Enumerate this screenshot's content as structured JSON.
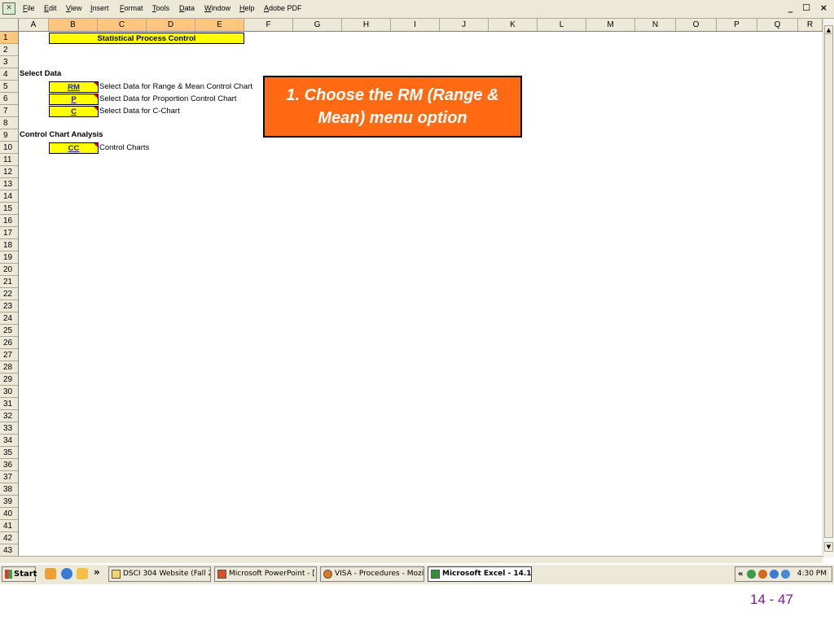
{
  "menubar": {
    "items": [
      "File",
      "Edit",
      "View",
      "Insert",
      "Format",
      "Tools",
      "Data",
      "Window",
      "Help",
      "Adobe PDF"
    ],
    "window_controls": "_ ☐ ×"
  },
  "columns": [
    "A",
    "B",
    "C",
    "D",
    "E",
    "F",
    "G",
    "H",
    "I",
    "J",
    "K",
    "L",
    "M",
    "N",
    "O",
    "P",
    "Q",
    "R"
  ],
  "rows": [
    "1",
    "2",
    "3",
    "4",
    "5",
    "6",
    "7",
    "8",
    "9",
    "10",
    "11",
    "12",
    "13",
    "14",
    "15",
    "16",
    "17",
    "18",
    "19",
    "20",
    "21",
    "22",
    "23",
    "24",
    "25",
    "26",
    "27",
    "28",
    "29",
    "30",
    "31",
    "32",
    "33",
    "34",
    "35",
    "36",
    "37",
    "38",
    "39",
    "40",
    "41",
    "42",
    "43"
  ],
  "sheet": {
    "title": "Statistical Process Control",
    "select_data_heading": "Select Data",
    "select_items": [
      {
        "code": "RM",
        "desc": "Select Data for Range & Mean Control Chart"
      },
      {
        "code": "P",
        "desc": "Select Data for Proportion Control Chart"
      },
      {
        "code": "C",
        "desc": "Select Data for C-Chart"
      }
    ],
    "analysis_heading": "Control Chart Analysis",
    "analysis_item": {
      "code": "CC",
      "desc": "Control Charts"
    }
  },
  "callout": {
    "line1": "1. Choose the RM (Range &",
    "line2": "Mean) menu option"
  },
  "taskbar": {
    "start_label": "Start",
    "chevron": "»",
    "tasks": [
      {
        "label": "DSCI 304 Website (Fall 2..."
      },
      {
        "label": "Microsoft PowerPoint - [..."
      },
      {
        "label": "VISA - Procedures - Mozil..."
      },
      {
        "label": "Microsoft Excel - 14.1 ..."
      }
    ],
    "tray_chevron": "«",
    "clock": "4:30 PM"
  },
  "slide_number": "14 - 47",
  "colors": {
    "callout_bg": "#ff6a13",
    "highlight_yellow": "#ffff00",
    "slide_number": "#7a1a9a"
  }
}
